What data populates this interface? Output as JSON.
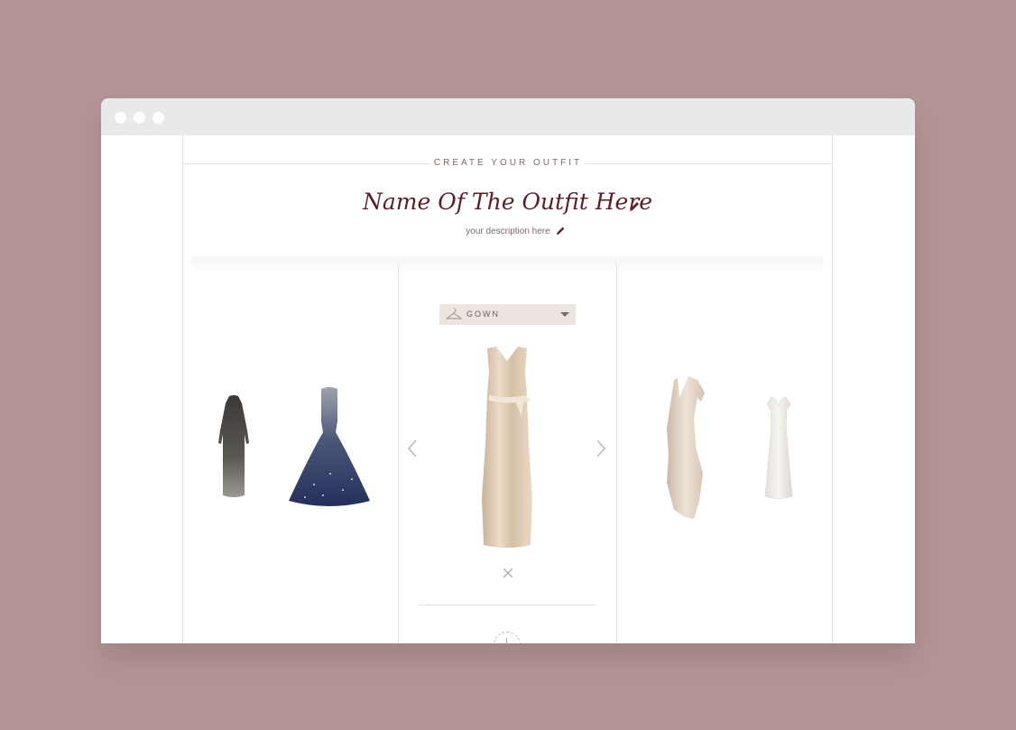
{
  "page": {
    "background_color": "#b39597",
    "accent_color": "#5a1e26"
  },
  "window": {
    "controls": [
      "window-dot",
      "window-dot",
      "window-dot"
    ]
  },
  "header": {
    "section_label": "CREATE YOUR OUTFIT",
    "outfit_name": "Name Of The Outfit Here",
    "description": "your description here",
    "edit_icon": "pencil-icon"
  },
  "selector": {
    "category_icon": "hanger-icon",
    "category_value": "GOWN",
    "caret_icon": "caret-down-icon"
  },
  "carousel": {
    "prev_icon": "chevron-left-icon",
    "next_icon": "chevron-right-icon",
    "remove_icon": "close-icon",
    "add_icon": "plus-icon"
  },
  "items": {
    "left": [
      "sequin-long-sleeve-gown",
      "navy-ball-gown"
    ],
    "center": [
      "champagne-satin-gown"
    ],
    "right": [
      "draped-satin-dress",
      "white-lace-gown"
    ]
  }
}
